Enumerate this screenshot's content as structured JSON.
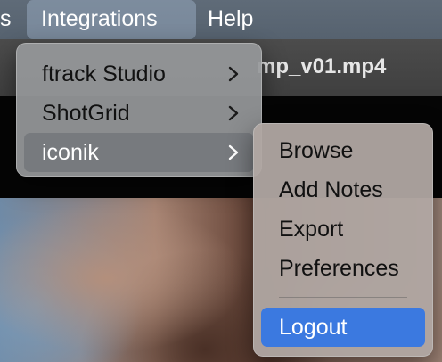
{
  "menubar": {
    "partial_left": "s",
    "integrations": "Integrations",
    "help": "Help"
  },
  "window": {
    "title_partial": "mp_v01.mp4"
  },
  "integrations_menu": {
    "items": [
      {
        "label": "ftrack Studio",
        "has_submenu": true
      },
      {
        "label": "ShotGrid",
        "has_submenu": true
      },
      {
        "label": "iconik",
        "has_submenu": true,
        "selected": true
      }
    ]
  },
  "iconik_submenu": {
    "items": [
      {
        "label": "Browse"
      },
      {
        "label": "Add Notes"
      },
      {
        "label": "Export"
      },
      {
        "label": "Preferences"
      }
    ],
    "logout": "Logout"
  },
  "colors": {
    "highlight": "#3b79e0",
    "menubar": "#5a6673"
  },
  "icons": {
    "submenu_indicator": "chevron-right-icon"
  }
}
